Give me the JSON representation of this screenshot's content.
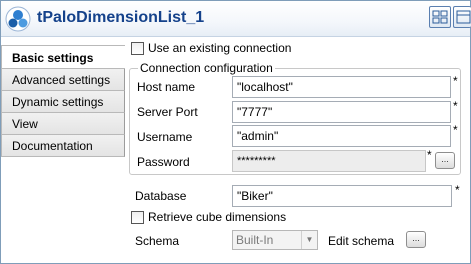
{
  "header": {
    "title": "tPaloDimensionList_1",
    "icons": [
      "palo-component-icon",
      "layout-view-icon",
      "layout-toggle-icon"
    ]
  },
  "tabs": [
    {
      "label": "Basic settings",
      "active": true
    },
    {
      "label": "Advanced settings",
      "active": false
    },
    {
      "label": "Dynamic settings",
      "active": false
    },
    {
      "label": "View",
      "active": false
    },
    {
      "label": "Documentation",
      "active": false
    }
  ],
  "settings": {
    "use_existing_connection": {
      "label": "Use an existing connection",
      "checked": false
    },
    "connection_group_title": "Connection configuration",
    "host": {
      "label": "Host name",
      "value": "\"localhost\"",
      "required": "*"
    },
    "port": {
      "label": "Server Port",
      "value": "\"7777\"",
      "required": "*"
    },
    "username": {
      "label": "Username",
      "value": "\"admin\"",
      "required": "*"
    },
    "password": {
      "label": "Password",
      "value": "*********",
      "required": "*",
      "button": "..."
    },
    "database": {
      "label": "Database",
      "value": "\"Biker\"",
      "required": "*"
    },
    "retrieve_cube": {
      "label": "Retrieve cube dimensions",
      "checked": false
    },
    "schema": {
      "label": "Schema",
      "value": "Built-In",
      "edit_label": "Edit schema",
      "button": "..."
    }
  }
}
